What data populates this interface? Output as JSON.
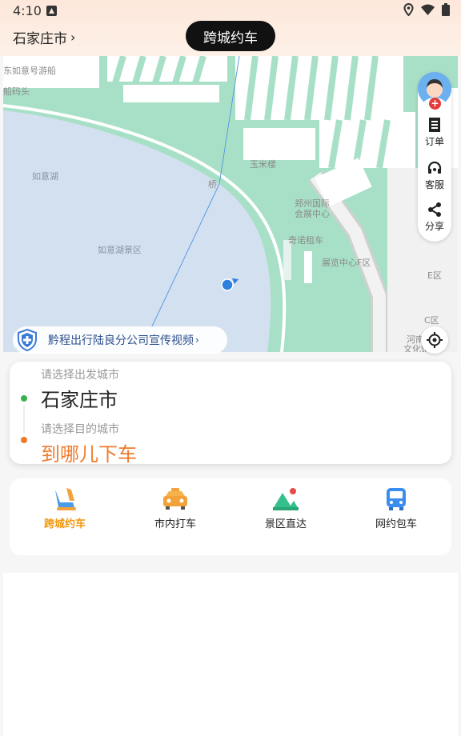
{
  "status": {
    "time": "4:10"
  },
  "header": {
    "city": "石家庄市",
    "chevron": "›",
    "title": "跨城约车"
  },
  "map": {
    "labels": {
      "l1": "东如意号游船",
      "l2": "船码头",
      "l3": "如意湖",
      "l4": "如意湖景区",
      "l5": "玉米楼",
      "l6": "郑州国际",
      "l7": "会展中心",
      "l8": "奇诺租车",
      "l9": "展览中心F区",
      "l10": "E区",
      "l11": "C区",
      "l12": "河南",
      "l13": "文化馆",
      "l14": "桥"
    }
  },
  "toolbar": {
    "orders": "订单",
    "service": "客服",
    "share": "分享"
  },
  "promo": {
    "text": "黔程出行陆良分公司宣传视频",
    "chevron": "›"
  },
  "trip": {
    "from_hint": "请选择出发城市",
    "from_city": "石家庄市",
    "to_hint": "请选择目的城市",
    "to_city": "到哪儿下车"
  },
  "services": [
    {
      "label": "跨城约车",
      "icon": "seat-icon",
      "active": true
    },
    {
      "label": "市内打车",
      "icon": "taxi-icon",
      "active": false
    },
    {
      "label": "景区直达",
      "icon": "scenic-icon",
      "active": false
    },
    {
      "label": "网约包车",
      "icon": "bus-icon",
      "active": false
    }
  ],
  "colors": {
    "accent": "#f2980d",
    "destination": "#ef7a2c",
    "origin_dot": "#3ab04a",
    "map_green": "#a8e0c7",
    "lake": "#d3e0ef"
  }
}
